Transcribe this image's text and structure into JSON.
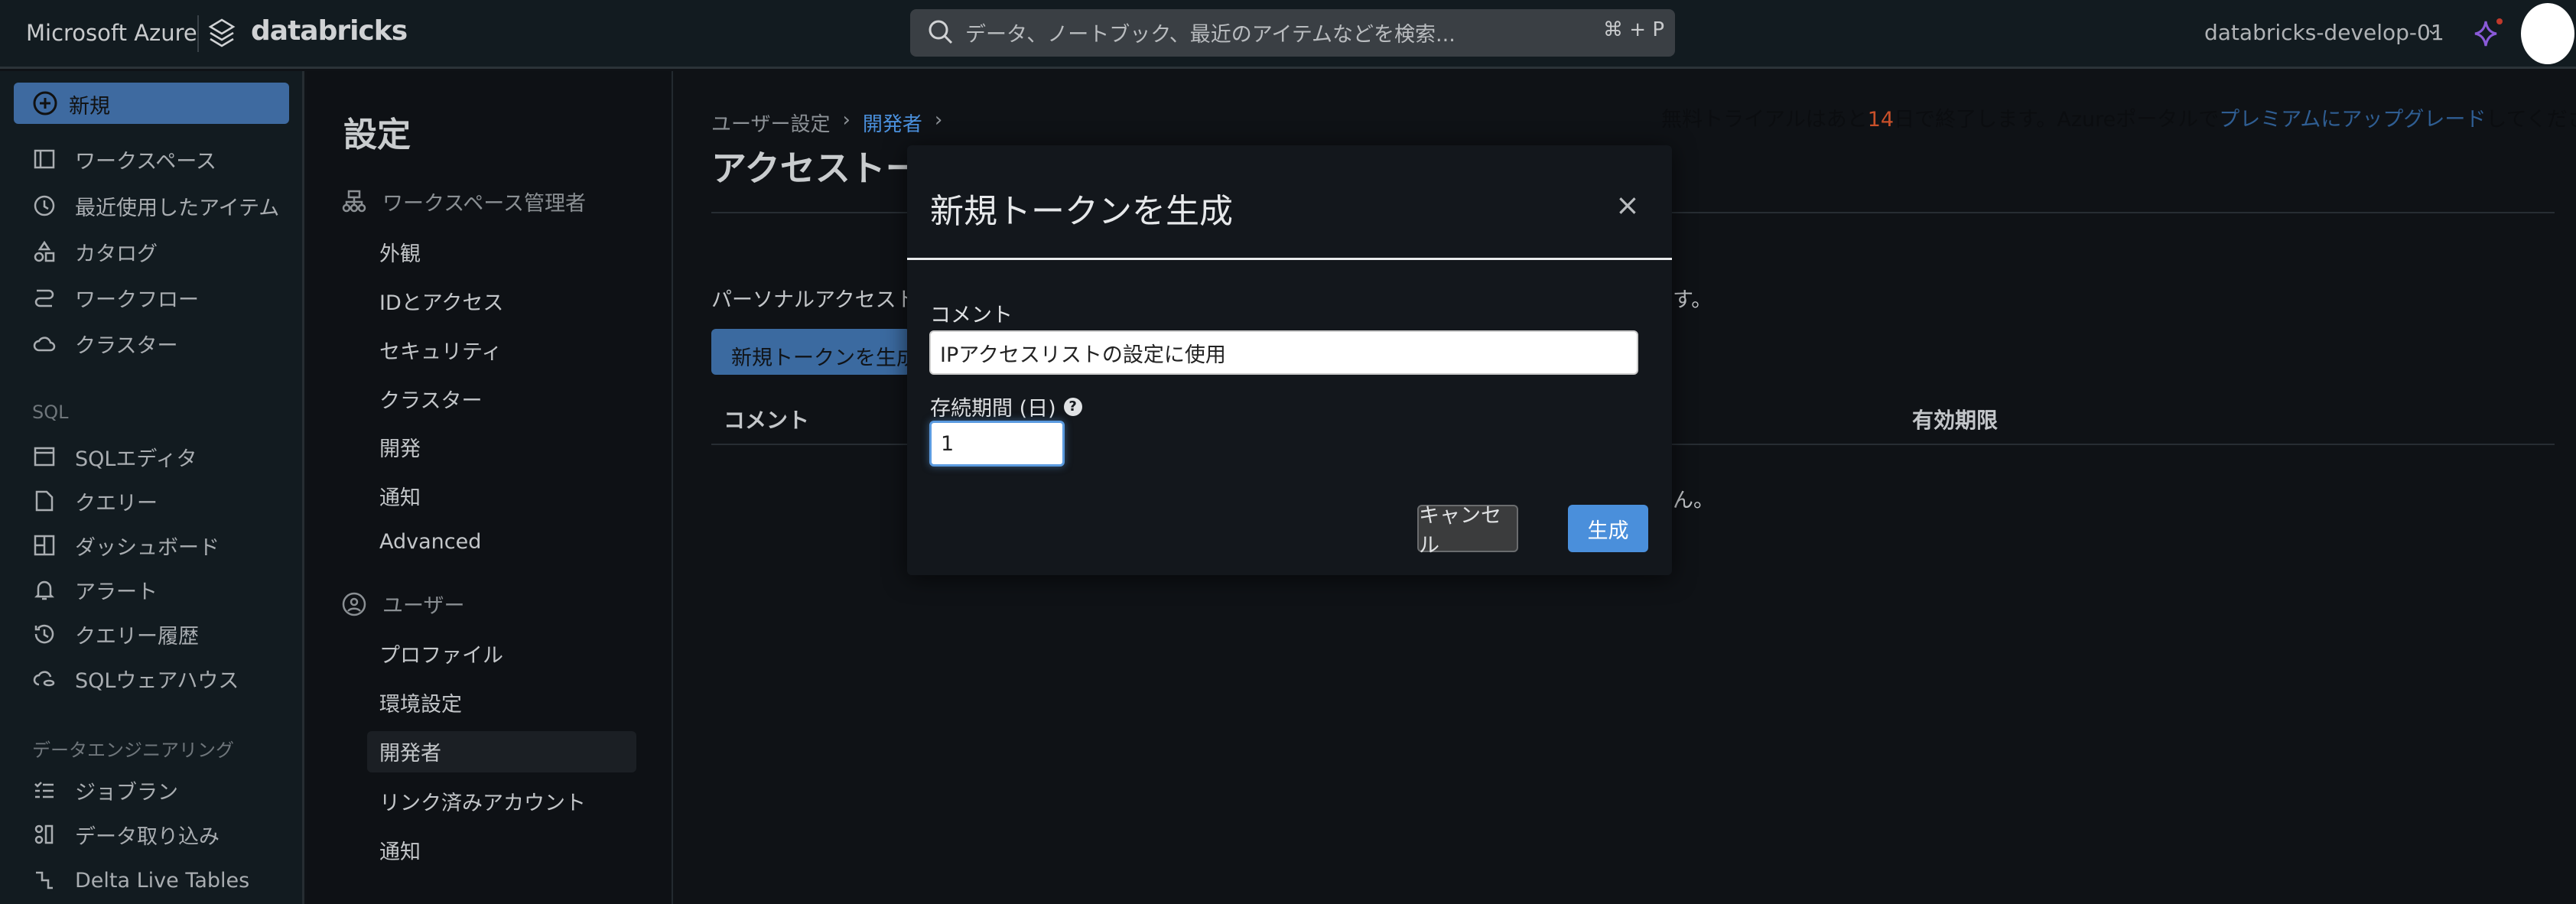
{
  "topbar": {
    "brand_ms": "Microsoft Azure",
    "brand_db": "databricks",
    "search_placeholder": "データ、ノートブック、最近のアイテムなどを検索...",
    "search_shortcut": "⌘ + P",
    "workspace_name": "databricks-develop-01",
    "workspace_chevron": "⌄"
  },
  "sidebar": {
    "new_label": "新規",
    "items": [
      {
        "label": "ワークスペース",
        "icon": "workspace-icon"
      },
      {
        "label": "最近使用したアイテム",
        "icon": "clock-icon"
      },
      {
        "label": "カタログ",
        "icon": "catalog-icon"
      },
      {
        "label": "ワークフロー",
        "icon": "workflow-icon"
      },
      {
        "label": "クラスター",
        "icon": "cloud-icon"
      }
    ],
    "sql_header": "SQL",
    "sql_items": [
      {
        "label": "SQLエディタ",
        "icon": "sql-editor-icon"
      },
      {
        "label": "クエリー",
        "icon": "query-icon"
      },
      {
        "label": "ダッシュボード",
        "icon": "dashboard-icon"
      },
      {
        "label": "アラート",
        "icon": "bell-icon"
      },
      {
        "label": "クエリー履歴",
        "icon": "history-icon"
      },
      {
        "label": "SQLウェアハウス",
        "icon": "warehouse-icon"
      }
    ],
    "de_header": "データエンジニアリング",
    "de_items": [
      {
        "label": "ジョブラン",
        "icon": "job-runs-icon"
      },
      {
        "label": "データ取り込み",
        "icon": "ingest-icon"
      },
      {
        "label": "Delta Live Tables",
        "icon": "dlt-icon"
      }
    ]
  },
  "settings_nav": {
    "title": "設定",
    "admin_header": "ワークスペース管理者",
    "admin_items": [
      "外観",
      "IDとアクセス",
      "セキュリティ",
      "クラスター",
      "開発",
      "通知",
      "Advanced"
    ],
    "user_header": "ユーザー",
    "user_items": [
      "プロファイル",
      "環境設定",
      "開発者",
      "リンク済みアカウント",
      "通知"
    ],
    "selected": "開発者"
  },
  "main": {
    "breadcrumb": [
      "ユーザー設定",
      "開発者"
    ],
    "breadcrumb_sep": "›",
    "title": "アクセストー",
    "trial_pre": "無料トライアルはあと",
    "trial_days": "14",
    "trial_mid": "日で終了します。Azureポータルで",
    "trial_link": "プレミアムにアップグレード",
    "trial_post": "してください",
    "desc_left": "パーソナルアクセスト",
    "desc_right": "ます。",
    "generate_button": "新規トークンを生成",
    "col_comment": "コメント",
    "col_expires": "有効期限",
    "empty_right": "せん。"
  },
  "modal": {
    "title": "新規トークンを生成",
    "close": "×",
    "comment_label": "コメント",
    "comment_value": "IPアクセスリストの設定に使用",
    "lifetime_label": "存続期間 (日)",
    "help": "?",
    "lifetime_value": "1",
    "cancel": "キャンセル",
    "generate": "生成"
  },
  "colors": {
    "accent": "#4a8fdb",
    "new_button": "#3e6aa0",
    "trial_days": "#c9502a"
  }
}
